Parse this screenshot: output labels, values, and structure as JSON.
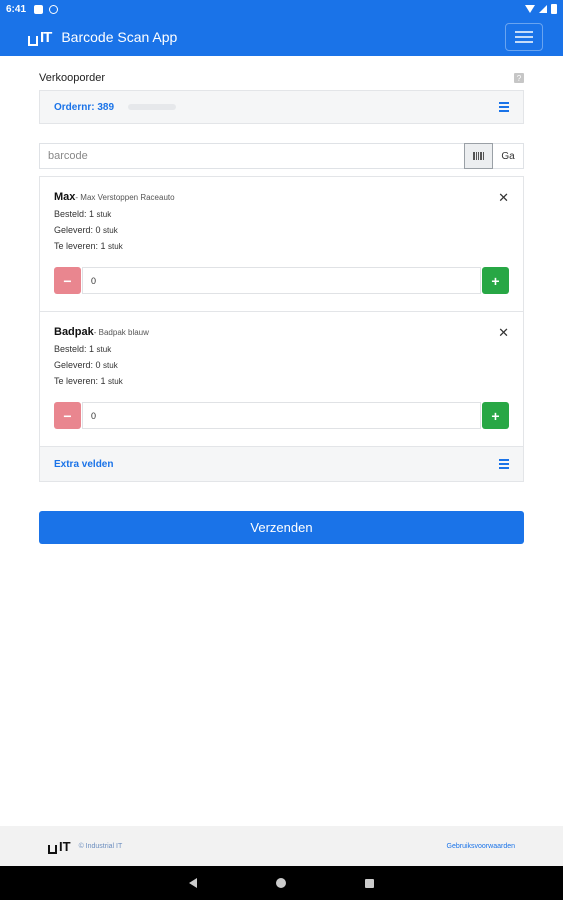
{
  "status_bar": {
    "time": "6:41"
  },
  "app_bar": {
    "logo": "IT",
    "title": "Barcode Scan App"
  },
  "sales_order": {
    "title": "Verkooporder",
    "help": "?",
    "order_number_label": "Ordernr: 389"
  },
  "barcode": {
    "placeholder": "barcode",
    "go_label": "Ga"
  },
  "items": [
    {
      "name": "Max",
      "description": "- Max Verstoppen Raceauto",
      "ordered_label": "Besteld: 1",
      "delivered_label": "Geleverd: 0",
      "to_deliver_label": "Te leveren: 1",
      "unit": "stuk",
      "quantity": "0",
      "minus": "−",
      "plus": "+",
      "close": "✕"
    },
    {
      "name": "Badpak",
      "description": "- Badpak blauw",
      "ordered_label": "Besteld: 1",
      "delivered_label": "Geleverd: 0",
      "to_deliver_label": "Te leveren: 1",
      "unit": "stuk",
      "quantity": "0",
      "minus": "−",
      "plus": "+",
      "close": "✕"
    }
  ],
  "extra_fields": {
    "label": "Extra velden"
  },
  "submit": {
    "label": "Verzenden"
  },
  "footer": {
    "logo": "IT",
    "copyright": "© Industrial IT",
    "terms": "Gebruiksvoorwaarden"
  },
  "colors": {
    "primary": "#1a73e8",
    "danger_light": "#e9868f",
    "success": "#28a745"
  }
}
